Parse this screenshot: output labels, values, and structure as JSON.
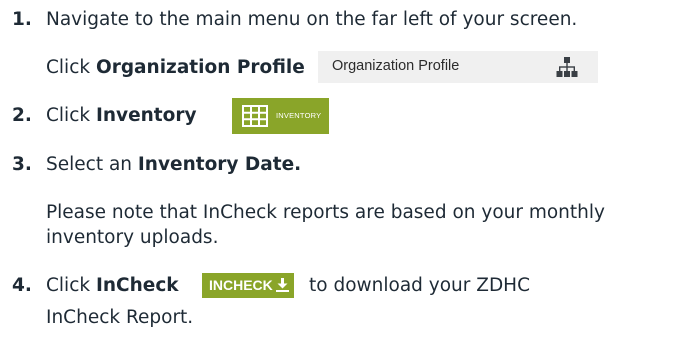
{
  "steps": [
    {
      "number": "1.",
      "text": "Navigate to the main menu on the far left of your screen.",
      "sub_prefix": "Click ",
      "sub_bold": "Organization Profile",
      "chip_label": "Organization Profile",
      "chip_icon": "org-chart-icon"
    },
    {
      "number": "2.",
      "prefix": "Click ",
      "bold": "Inventory",
      "button_label": "INVENTORY",
      "button_icon": "grid-table-icon"
    },
    {
      "number": "3.",
      "prefix": "Select an ",
      "bold": "Inventory Date.",
      "note_line1": "Please note that InCheck reports are based on your monthly",
      "note_line2": "inventory uploads."
    },
    {
      "number": "4.",
      "prefix": "Click ",
      "bold": "InCheck",
      "button_label": "INCHECK",
      "button_icon": "download-icon",
      "suffix": "to download your ZDHC",
      "line2": "InCheck Report."
    }
  ],
  "colors": {
    "text": "#1e2a35",
    "accent_green": "#8aa529",
    "chip_bg": "#f0f0f0"
  }
}
